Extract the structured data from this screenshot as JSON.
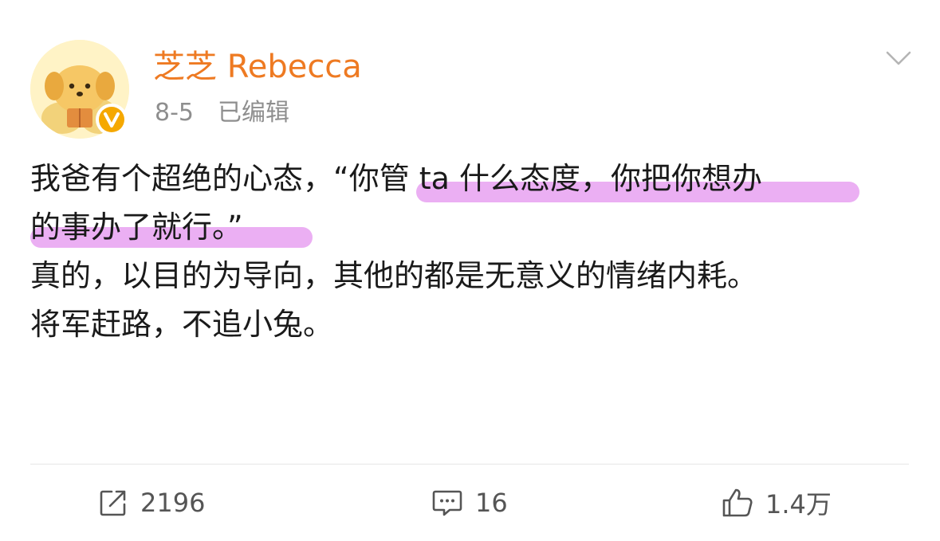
{
  "user": {
    "name": "芝芝 Rebecca",
    "date": "8-5",
    "edited": "已编辑"
  },
  "post": {
    "lines": [
      "我爸有个超绝的心态，“你管 ta 什么态度，你把你想办",
      "的事办了就行。”",
      "真的，以目的为导向，其他的都是无意义的情绪内耗。",
      "将军赶路，不追小兔。"
    ]
  },
  "actions": {
    "repost_count": "2196",
    "comment_count": "16",
    "like_count": "1.4万"
  },
  "icons": {
    "avatar": "cartoon-dog-avatar",
    "badge": "verified-v-badge",
    "menu": "chevron-down-icon",
    "repost": "share-icon",
    "comment": "comment-icon",
    "like": "thumbs-up-icon"
  },
  "colors": {
    "username": "#ee7a22",
    "highlight": "#e9a6f2",
    "badge": "#f5a800"
  }
}
